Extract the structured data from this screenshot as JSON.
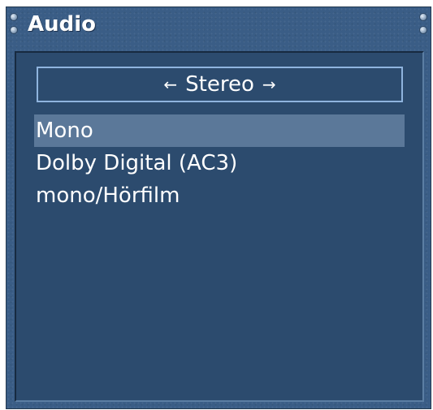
{
  "dialog": {
    "title": "Audio"
  },
  "selector": {
    "left_arrow": "←",
    "value": "Stereo",
    "right_arrow": "→"
  },
  "options": [
    {
      "label": "Mono",
      "selected": true
    },
    {
      "label": "Dolby Digital (AC3)",
      "selected": false
    },
    {
      "label": "mono/Hörfilm",
      "selected": false
    }
  ],
  "colors": {
    "frame": "#3a5d86",
    "panel": "#2c4b6e",
    "highlight": "#5b7899",
    "selector_border": "#8fb4de",
    "text": "#ffffff"
  }
}
